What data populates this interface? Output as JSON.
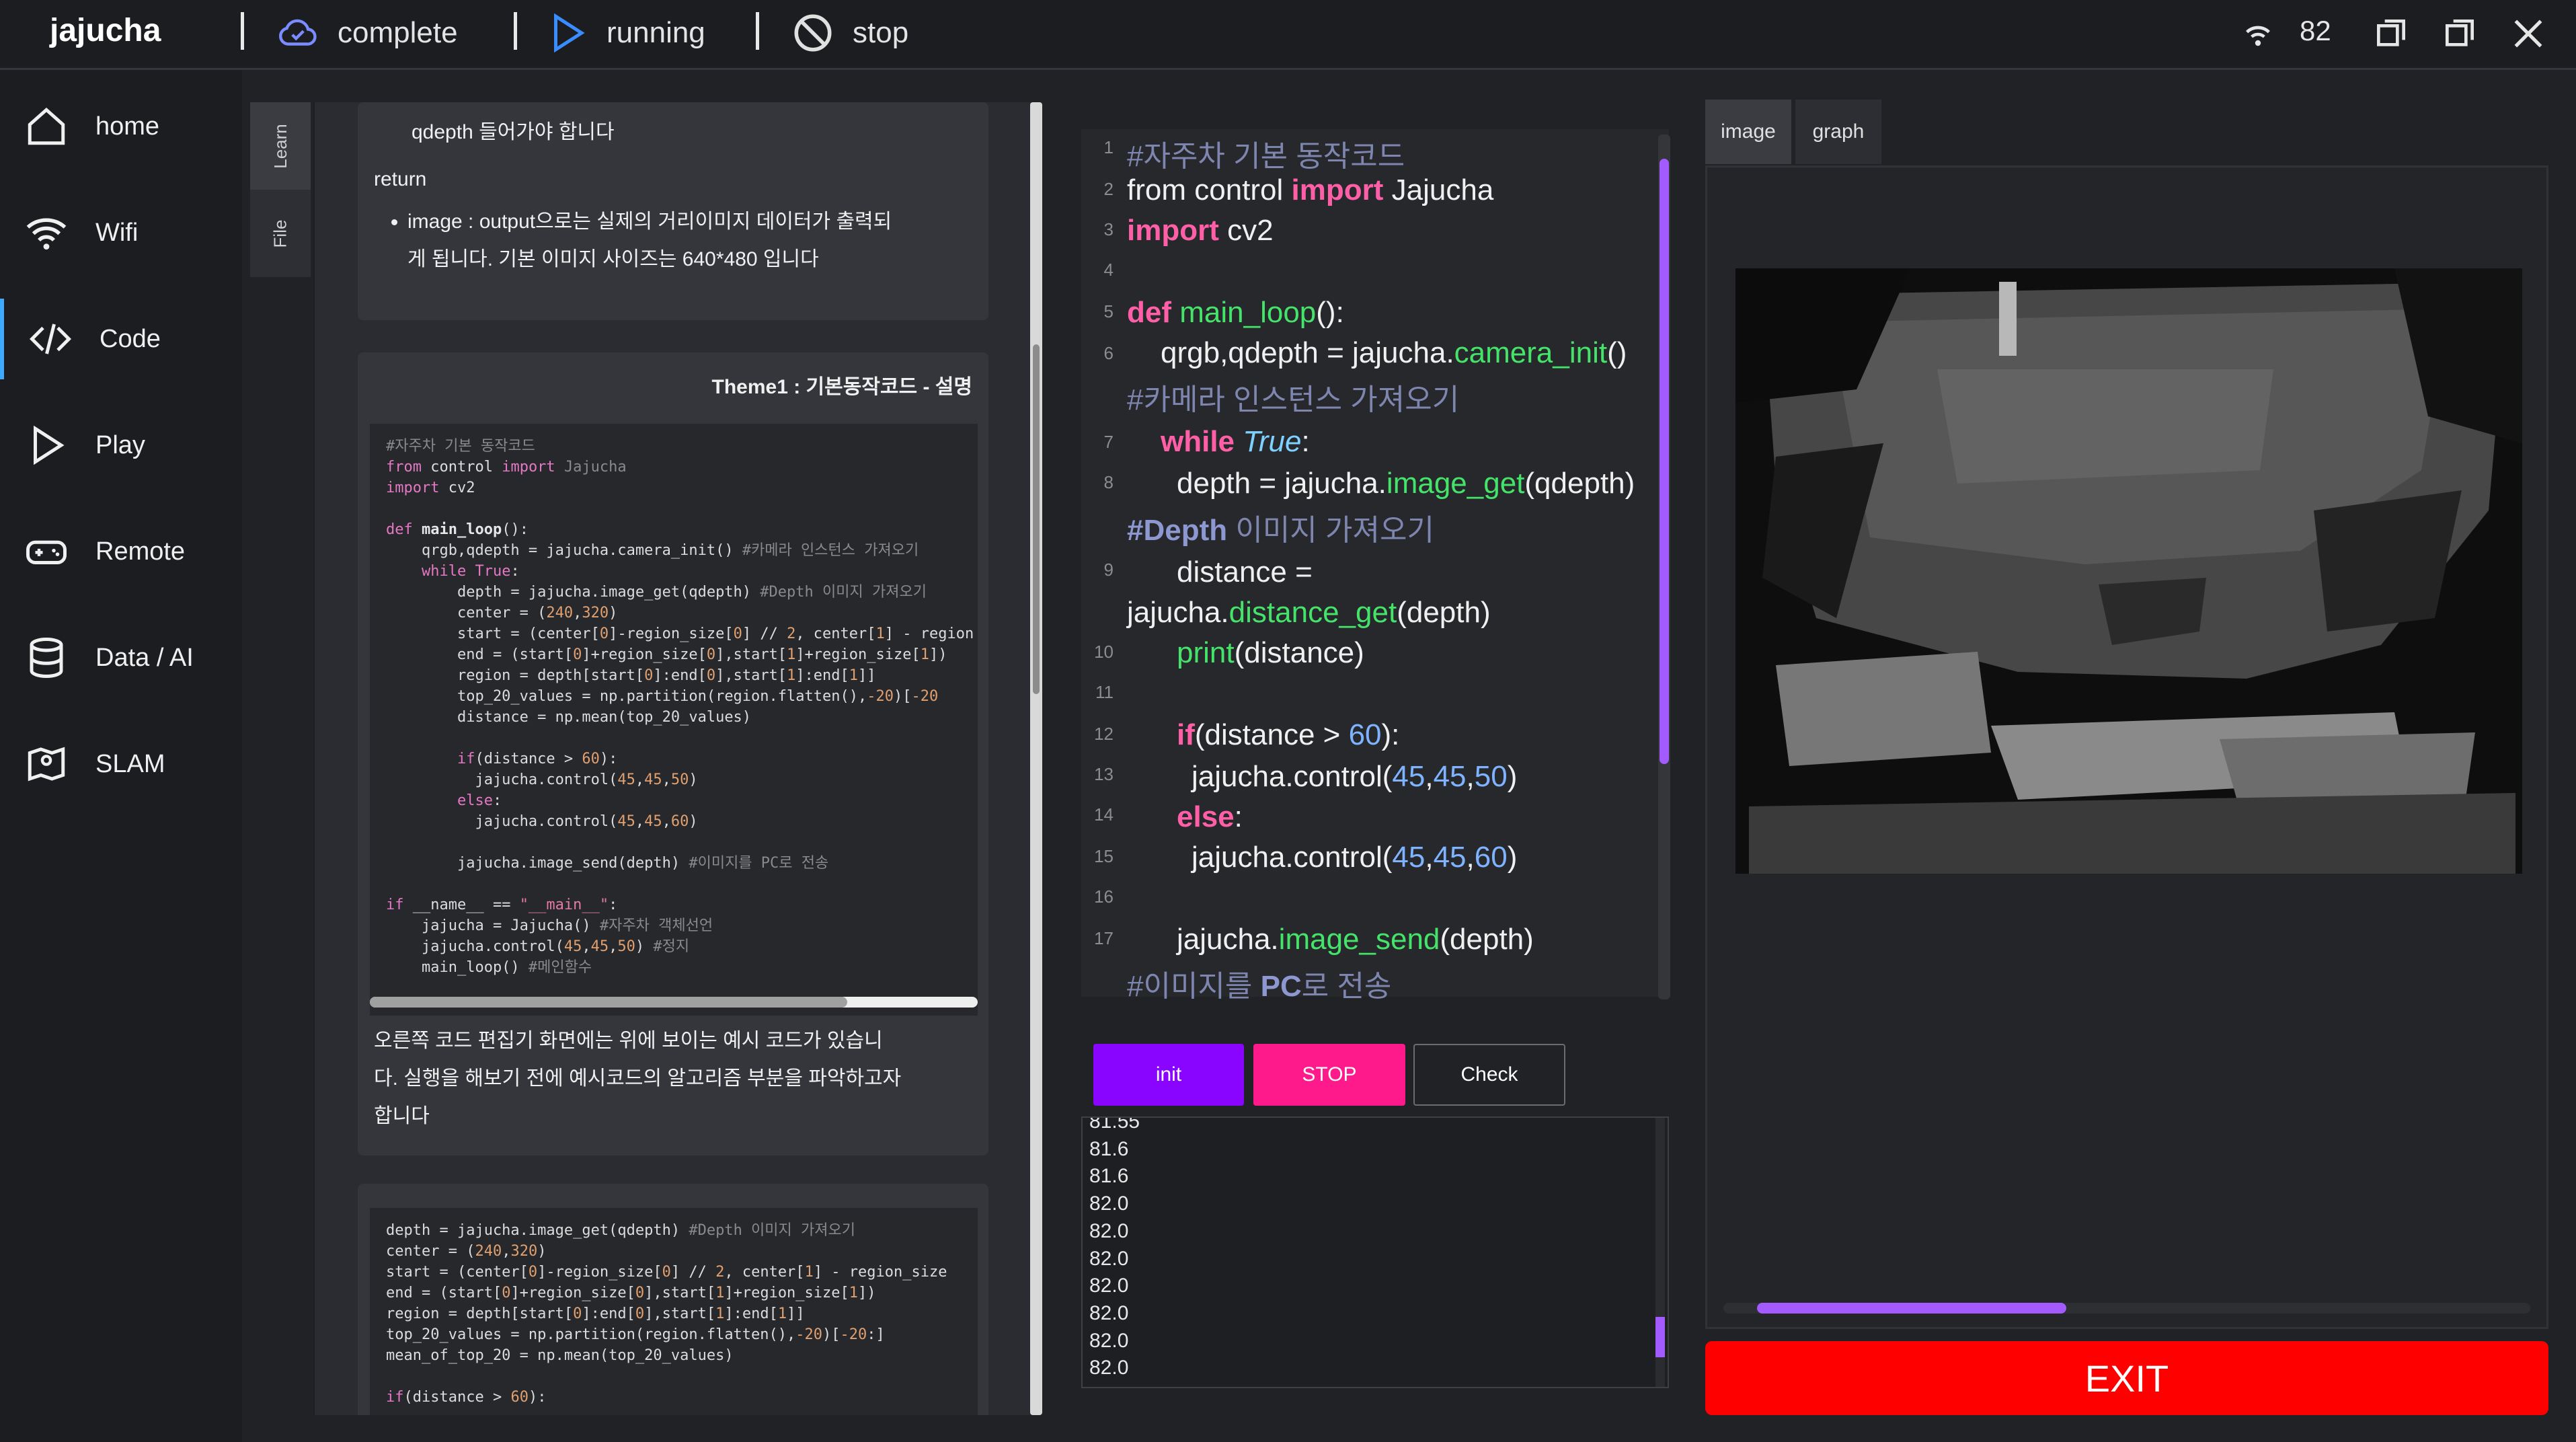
{
  "topbar": {
    "brand": "jajucha",
    "status_complete": "complete",
    "status_running": "running",
    "status_stop": "stop",
    "battery": "82"
  },
  "sidebar": {
    "items": [
      {
        "label": "home",
        "icon": "home-icon"
      },
      {
        "label": "Wifi",
        "icon": "wifi-icon"
      },
      {
        "label": "Code",
        "icon": "code-icon"
      },
      {
        "label": "Play",
        "icon": "play-icon"
      },
      {
        "label": "Remote",
        "icon": "gamepad-icon"
      },
      {
        "label": "Data / AI",
        "icon": "database-icon"
      },
      {
        "label": "SLAM",
        "icon": "map-icon"
      }
    ]
  },
  "learn_tabs": [
    "Learn",
    "File"
  ],
  "learn": {
    "card1_line1": "qdepth 들어가야 합니다",
    "card1_return": "return",
    "card1_bullet": "image : output으로는 실제의 거리이미지 데이터가 출력되",
    "card1_bullet2": "게 됩니다. 기본 이미지 사이즈는 640*480 입니다",
    "card2_title": "Theme1 : 기본동작코드 - 설명",
    "card2_desc1": "오른쪽 코드 편집기 화면에는 위에 보이는 예시 코드가 있습니",
    "card2_desc2": "다. 실행을 해보기 전에 예시코드의 알고리즘 부분을 파악하고자",
    "card2_desc3": "합니다"
  },
  "editor": {
    "line_numbers": [
      "1",
      "2",
      "3",
      "4",
      "5",
      "6",
      "7",
      "8",
      "9",
      "10",
      "11",
      "12",
      "13",
      "14",
      "15",
      "16",
      "17"
    ]
  },
  "buttons": {
    "init": "init",
    "stop": "STOP",
    "check": "Check"
  },
  "console": [
    "81.55",
    "81.6",
    "81.6",
    "82.0",
    "82.0",
    "82.0",
    "82.0",
    "82.0",
    "82.0",
    "82.0"
  ],
  "view_tabs": [
    "image",
    "graph"
  ],
  "exit_label": "EXIT",
  "colors": {
    "accent": "#a35bff",
    "stop": "#ff1a8c",
    "init": "#8a05ff",
    "exit": "#ff0000"
  }
}
